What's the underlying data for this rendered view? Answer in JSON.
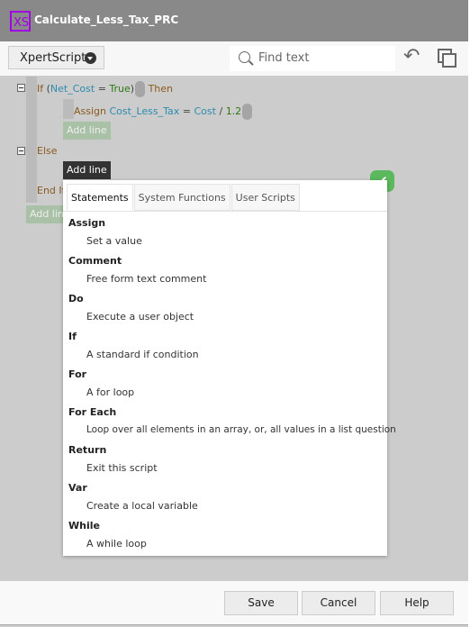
{
  "window": {
    "logo": "XS",
    "title": "Calculate_Less_Tax_PRC"
  },
  "toolbar": {
    "language": "XpertScript",
    "find_placeholder": "Find text",
    "undo_icon": "undo-icon",
    "copy_icon": "copy-icon"
  },
  "script": {
    "if_kw": "If",
    "open": "(",
    "if_var": "Net_Cost",
    "eq": "=",
    "if_val": "True",
    "close": ")",
    "then_kw": "Then",
    "assign_kw": "Assign",
    "assign_var": "Cost_Less_Tax",
    "assign_eq": "=",
    "assign_rhs_var": "Cost",
    "assign_op": "/",
    "assign_rhs_val": "1.2",
    "pill": "...",
    "else_kw": "Else",
    "endif_kw": "End If",
    "add_line": "Add line"
  },
  "colors": {
    "keyword": "#8a5a1e",
    "variable": "#2e8bb0",
    "literal": "#2a7a12",
    "confirm": "#5cb85c",
    "logo": "#a100e0"
  },
  "popup": {
    "tabs": [
      {
        "label": "Statements",
        "selected": true
      },
      {
        "label": "System Functions"
      },
      {
        "label": "User Scripts"
      }
    ],
    "items": [
      {
        "name": "Assign",
        "desc": "Set a value"
      },
      {
        "name": "Comment",
        "desc": "Free form text comment"
      },
      {
        "name": "Do",
        "desc": "Execute a user object"
      },
      {
        "name": "If",
        "desc": "A standard if condition"
      },
      {
        "name": "For",
        "desc": "A for loop"
      },
      {
        "name": "For Each",
        "desc": "Loop over all elements in an array, or, all values in a list question"
      },
      {
        "name": "Return",
        "desc": "Exit this script"
      },
      {
        "name": "Var",
        "desc": "Create a local variable"
      },
      {
        "name": "While",
        "desc": "A while loop"
      }
    ]
  },
  "footer": {
    "save": "Save",
    "cancel": "Cancel",
    "help": "Help"
  }
}
